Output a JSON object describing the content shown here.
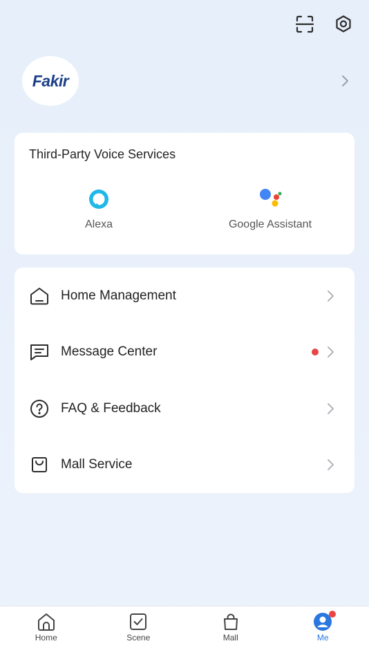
{
  "header": {
    "scan_icon": "scan-icon",
    "settings_icon": "settings-gear-icon"
  },
  "profile": {
    "avatar_text": "Fakir",
    "chevron_icon": "chevron-right-icon"
  },
  "voice_services": {
    "title": "Third-Party Voice Services",
    "items": [
      {
        "label": "Alexa",
        "icon": "alexa-icon"
      },
      {
        "label": "Google Assistant",
        "icon": "google-assistant-icon"
      }
    ]
  },
  "menu": {
    "items": [
      {
        "label": "Home Management",
        "icon": "home-icon",
        "badge": false
      },
      {
        "label": "Message Center",
        "icon": "message-icon",
        "badge": true
      },
      {
        "label": "FAQ & Feedback",
        "icon": "help-icon",
        "badge": false
      },
      {
        "label": "Mall Service",
        "icon": "mall-service-icon",
        "badge": false
      }
    ]
  },
  "tabbar": {
    "items": [
      {
        "label": "Home",
        "icon": "home-tab-icon",
        "active": false
      },
      {
        "label": "Scene",
        "icon": "scene-tab-icon",
        "active": false
      },
      {
        "label": "Mall",
        "icon": "mall-tab-icon",
        "active": false
      },
      {
        "label": "Me",
        "icon": "me-tab-icon",
        "active": true,
        "badge": true
      }
    ]
  },
  "colors": {
    "accent": "#2a77e0",
    "badge": "#e84545",
    "background": "#e9f0fa",
    "card": "#ffffff",
    "brand": "#1c3f8a"
  }
}
